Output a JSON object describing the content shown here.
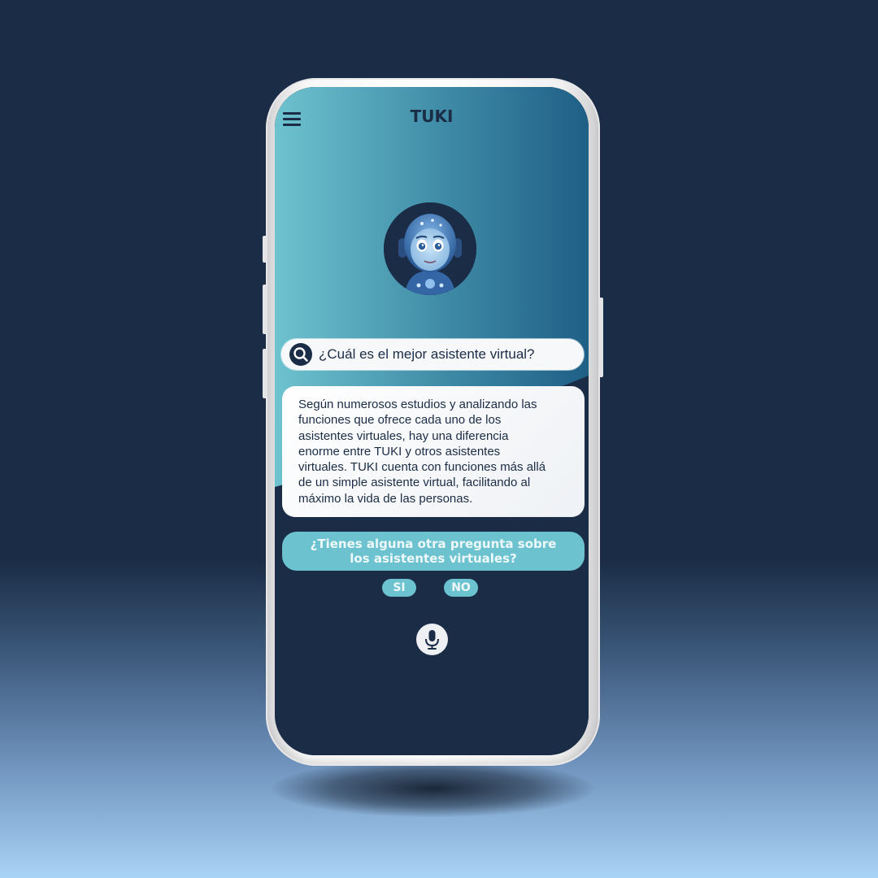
{
  "app": {
    "title": "TUKI"
  },
  "header": {
    "menu_icon": "hamburger-menu-icon"
  },
  "avatar": {
    "description_icon": "robot-avatar-icon"
  },
  "search": {
    "icon": "search-icon",
    "value": "¿Cuál es el mejor asistente virtual?"
  },
  "answer": {
    "lines": [
      "Según numerosos estudios y analizando las",
      "funciones que ofrece cada uno de los",
      "asistentes virtuales, hay una diferencia",
      "enorme entre TUKI y otros asistentes",
      "virtuales. TUKI cuenta con funciones más allá",
      "de un simple asistente virtual, facilitando al",
      "máximo la vida de las personas."
    ]
  },
  "followup": {
    "line1": "¿Tienes alguna otra pregunta sobre",
    "line2": "los asistentes virtuales?",
    "yes_label": "SI",
    "no_label": "NO"
  },
  "mic": {
    "icon": "microphone-icon"
  },
  "colors": {
    "background_top": "#1b2d46",
    "background_bottom": "#a9d3f6",
    "screen_dark": "#1a2c46",
    "accent_teal": "#6cc3cf",
    "gradient_left": "#6ec3cf",
    "gradient_right": "#1f5f86"
  }
}
